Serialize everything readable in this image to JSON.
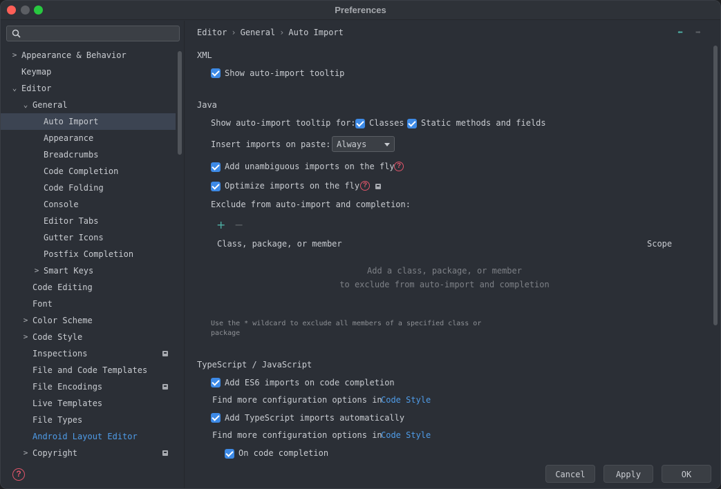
{
  "window": {
    "title": "Preferences"
  },
  "search": {
    "placeholder": "",
    "value": ""
  },
  "sidebar": {
    "items": [
      {
        "label": "Appearance & Behavior",
        "arrow": "›"
      },
      {
        "label": "Keymap"
      },
      {
        "label": "Editor",
        "arrow": "⌄"
      },
      {
        "label": "General",
        "arrow": "⌄"
      },
      {
        "label": "Auto Import"
      },
      {
        "label": "Appearance"
      },
      {
        "label": "Breadcrumbs"
      },
      {
        "label": "Code Completion"
      },
      {
        "label": "Code Folding"
      },
      {
        "label": "Console"
      },
      {
        "label": "Editor Tabs"
      },
      {
        "label": "Gutter Icons"
      },
      {
        "label": "Postfix Completion"
      },
      {
        "label": "Smart Keys",
        "arrow": "›"
      },
      {
        "label": "Code Editing"
      },
      {
        "label": "Font"
      },
      {
        "label": "Color Scheme",
        "arrow": "›"
      },
      {
        "label": "Code Style",
        "arrow": "›"
      },
      {
        "label": "Inspections"
      },
      {
        "label": "File and Code Templates"
      },
      {
        "label": "File Encodings"
      },
      {
        "label": "Live Templates"
      },
      {
        "label": "File Types"
      },
      {
        "label": "Android Layout Editor"
      },
      {
        "label": "Copyright",
        "arrow": "›"
      }
    ]
  },
  "breadcrumb": {
    "part1": "Editor",
    "part2": "General",
    "part3": "Auto Import",
    "sep": "›"
  },
  "xml": {
    "title": "XML",
    "show_tooltip": "Show auto-import tooltip"
  },
  "java": {
    "title": "Java",
    "tooltip_for": "Show auto-import tooltip for:",
    "classes": "Classes",
    "static_methods": "Static methods and fields",
    "insert_on_paste": "Insert imports on paste:",
    "insert_on_paste_value": "Always",
    "add_unambiguous": "Add unambiguous imports on the fly",
    "optimize": "Optimize imports on the fly",
    "exclude_label": "Exclude from auto-import and completion:",
    "col_member": "Class, package, or member",
    "col_scope": "Scope",
    "empty_line1": "Add a class, package, or member",
    "empty_line2": "to exclude from auto-import and completion",
    "hint": "Use the * wildcard to exclude all members of a specified class or package"
  },
  "ts": {
    "title": "TypeScript / JavaScript",
    "add_es6": "Add ES6 imports on code completion",
    "find_more_1": "Find more configuration options in",
    "code_style_link_1": "Code Style",
    "add_ts": "Add TypeScript imports automatically",
    "find_more_2": "Find more configuration options in",
    "code_style_link_2": "Code Style",
    "on_completion": "On code completion"
  },
  "buttons": {
    "cancel": "Cancel",
    "apply": "Apply",
    "ok": "OK"
  },
  "colors": {
    "accent": "#3d8ae6",
    "link": "#4f9ce8",
    "help": "#e0556a"
  }
}
